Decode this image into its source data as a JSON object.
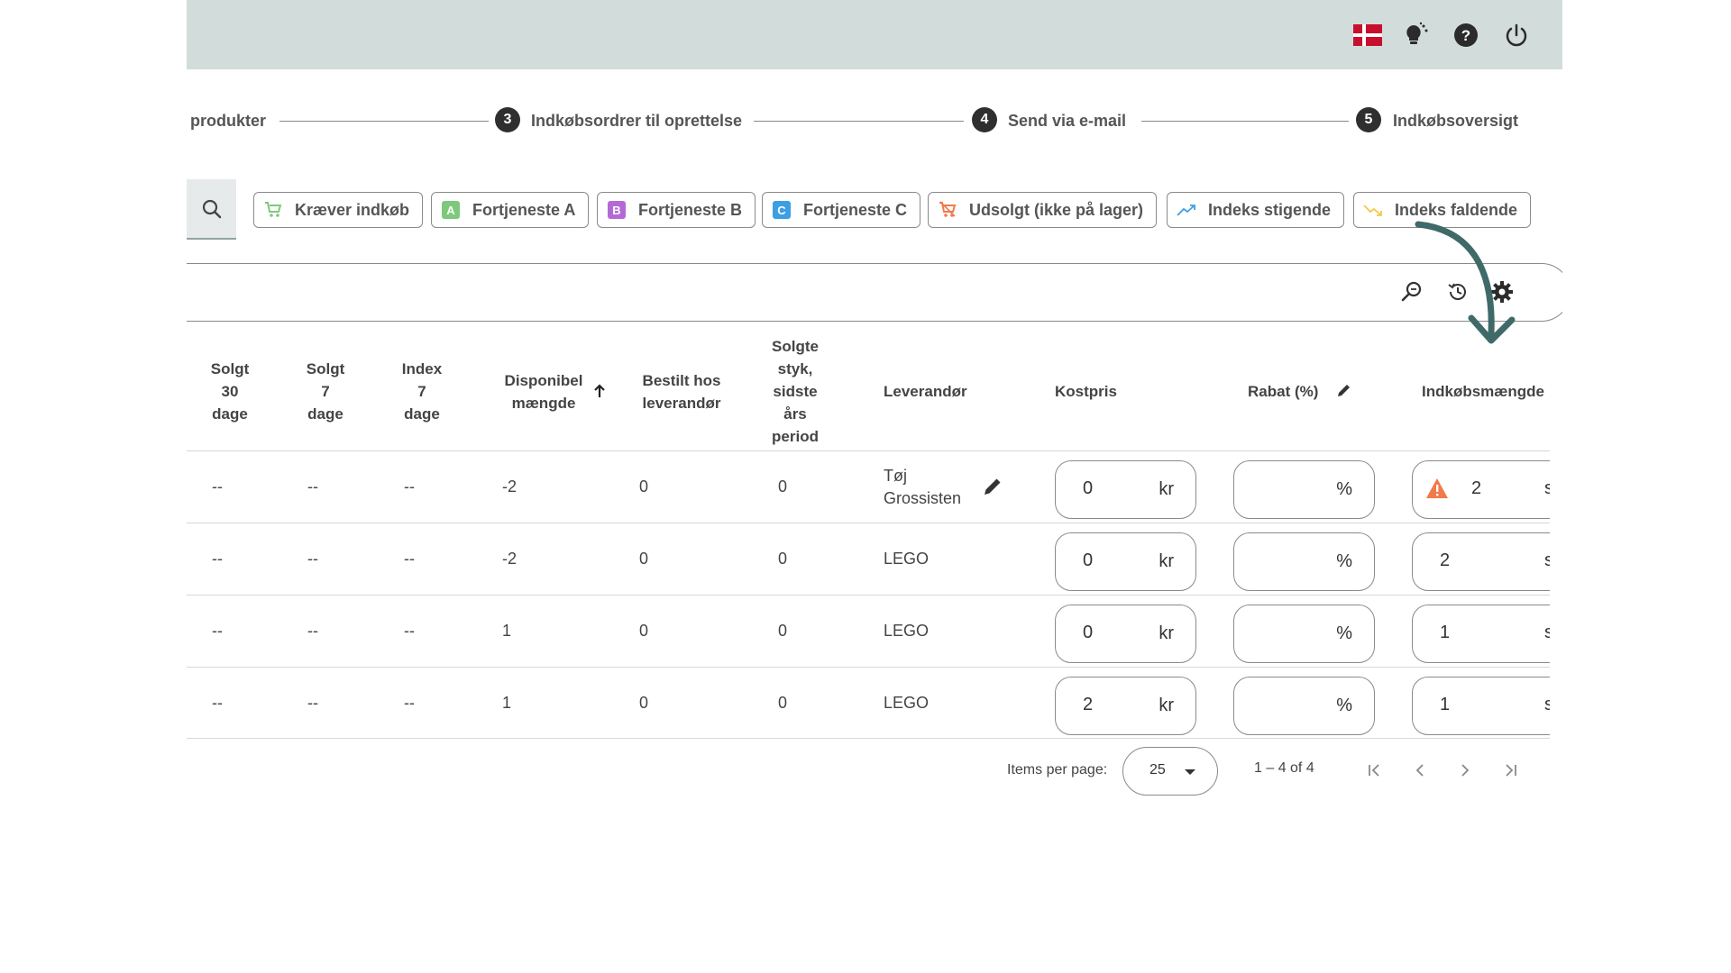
{
  "topbar": {
    "icons": [
      "danish-flag-icon",
      "lightbulb-icon",
      "help-icon",
      "power-icon"
    ],
    "background": "#d2dcdb"
  },
  "stepper": {
    "step_partial_label": "produkter",
    "steps": [
      {
        "number": "3",
        "label": "Indkøbsordrer til oprettelse"
      },
      {
        "number": "4",
        "label": "Send via e-mail"
      },
      {
        "number": "5",
        "label": "Indkøbsoversigt"
      }
    ]
  },
  "filters": {
    "chips": [
      {
        "label": "Kræver indkøb",
        "icon": "cart-icon"
      },
      {
        "label": "Fortjeneste A",
        "badge": "A",
        "badge_color": "#7ec87b"
      },
      {
        "label": "Fortjeneste B",
        "badge": "B",
        "badge_color": "#b46ad6"
      },
      {
        "label": "Fortjeneste C",
        "badge": "C",
        "badge_color": "#3d9fe3"
      },
      {
        "label": "Udsolgt (ikke på lager)",
        "icon": "cart-off-icon"
      },
      {
        "label": "Indeks stigende",
        "icon": "trending-up-icon"
      },
      {
        "label": "Indeks faldende",
        "icon": "trending-down-icon"
      }
    ]
  },
  "table": {
    "columns": {
      "sold30": [
        "Solgt",
        "30",
        "dage"
      ],
      "sold7": [
        "Solgt",
        "7",
        "dage"
      ],
      "index7": [
        "Index",
        "7",
        "dage"
      ],
      "available": [
        "Disponibel",
        "mængde"
      ],
      "ordered": [
        "Bestilt hos",
        "leverandør"
      ],
      "soldLastYear": [
        "Solgte",
        "styk,",
        "sidste",
        "års",
        "period"
      ],
      "supplier": "Leverandør",
      "cost": "Kostpris",
      "discount": "Rabat (%)",
      "purchaseQty": "Indkøbsmængde"
    },
    "cost_unit": "kr",
    "discount_unit": "%",
    "rows": [
      {
        "sold30": "--",
        "sold7": "--",
        "index7": "--",
        "available": "-2",
        "ordered": "0",
        "soldLastYear": "0",
        "supplier": "Tøj Grossisten",
        "cost": "0",
        "discount": "",
        "qty": "2",
        "qty_warning": true
      },
      {
        "sold30": "--",
        "sold7": "--",
        "index7": "--",
        "available": "-2",
        "ordered": "0",
        "soldLastYear": "0",
        "supplier": "LEGO",
        "cost": "0",
        "discount": "",
        "qty": "2",
        "qty_warning": false
      },
      {
        "sold30": "--",
        "sold7": "--",
        "index7": "--",
        "available": "1",
        "ordered": "0",
        "soldLastYear": "0",
        "supplier": "LEGO",
        "cost": "0",
        "discount": "",
        "qty": "1",
        "qty_warning": false
      },
      {
        "sold30": "--",
        "sold7": "--",
        "index7": "--",
        "available": "1",
        "ordered": "0",
        "soldLastYear": "0",
        "supplier": "LEGO",
        "cost": "2",
        "discount": "",
        "qty": "1",
        "qty_warning": false
      }
    ]
  },
  "pagination": {
    "label": "Items per page:",
    "page_size": "25",
    "range": "1 – 4 of 4"
  },
  "colors": {
    "arrow": "#3f6a69",
    "warning": "#f07a4a"
  }
}
